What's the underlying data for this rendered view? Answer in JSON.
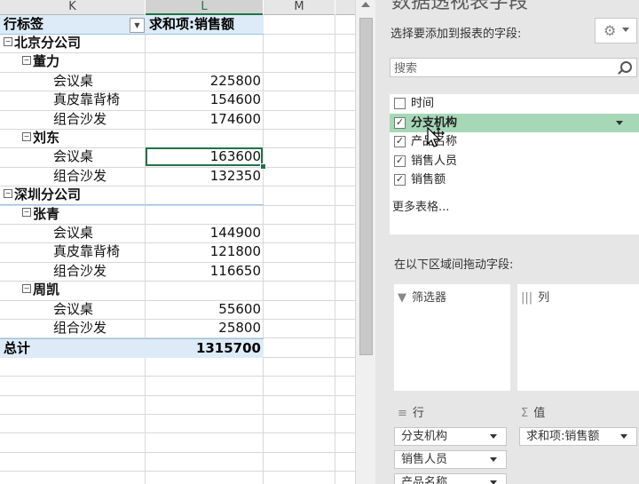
{
  "sheet": {
    "columns": [
      {
        "label": "K"
      },
      {
        "label": "L"
      },
      {
        "label": "M"
      }
    ],
    "pivot": {
      "header_row_label": "行标签",
      "header_value_label": "求和项:销售额",
      "rows": [
        {
          "level": 0,
          "collapse": "⊟",
          "label": "北京分公司",
          "value": ""
        },
        {
          "level": 1,
          "collapse": "⊟",
          "label": "董力",
          "value": ""
        },
        {
          "level": 2,
          "collapse": "",
          "label": "会议桌",
          "value": "225800"
        },
        {
          "level": 2,
          "collapse": "",
          "label": "真皮靠背椅",
          "value": "154600"
        },
        {
          "level": 2,
          "collapse": "",
          "label": "组合沙发",
          "value": "174600"
        },
        {
          "level": 1,
          "collapse": "⊟",
          "label": "刘东",
          "value": ""
        },
        {
          "level": 2,
          "collapse": "",
          "label": "会议桌",
          "value": "163600"
        },
        {
          "level": 2,
          "collapse": "",
          "label": "组合沙发",
          "value": "132350"
        },
        {
          "level": 0,
          "collapse": "⊟",
          "label": "深圳分公司",
          "value": ""
        },
        {
          "level": 1,
          "collapse": "⊟",
          "label": "张青",
          "value": ""
        },
        {
          "level": 2,
          "collapse": "",
          "label": "会议桌",
          "value": "144900"
        },
        {
          "level": 2,
          "collapse": "",
          "label": "真皮靠背椅",
          "value": "121800"
        },
        {
          "level": 2,
          "collapse": "",
          "label": "组合沙发",
          "value": "116650"
        },
        {
          "level": 1,
          "collapse": "⊟",
          "label": "周凯",
          "value": ""
        },
        {
          "level": 2,
          "collapse": "",
          "label": "会议桌",
          "value": "55600"
        },
        {
          "level": 2,
          "collapse": "",
          "label": "组合沙发",
          "value": "25800"
        }
      ],
      "total_label": "总计",
      "total_value": "1315700"
    }
  },
  "pane": {
    "title": "数据透视表字段",
    "choose_fields": "选择要添加到报表的字段:",
    "gear_icon": "gear-icon",
    "search_placeholder": "搜索",
    "fields": [
      {
        "label": "时间",
        "checked": false,
        "highlighted": false
      },
      {
        "label": "分支机构",
        "checked": true,
        "highlighted": true
      },
      {
        "label": "产品名称",
        "checked": true,
        "highlighted": false
      },
      {
        "label": "销售人员",
        "checked": true,
        "highlighted": false
      },
      {
        "label": "销售额",
        "checked": true,
        "highlighted": false
      }
    ],
    "more_tables": "更多表格...",
    "drag_instruction": "在以下区域间拖动字段:",
    "areas": {
      "filters": {
        "title": "筛选器",
        "icon": "filter-icon"
      },
      "columns": {
        "title": "列",
        "icon": "columns-icon"
      },
      "rows": {
        "title": "行",
        "icon": "rows-icon",
        "items": [
          "分支机构",
          "销售人员",
          "产品名称"
        ]
      },
      "values": {
        "title": "值",
        "icon": "sigma-icon",
        "items": [
          "求和项:销售额"
        ]
      }
    }
  },
  "colors": {
    "pivot_header_bg": "#dcebf7",
    "selection_green": "#217346",
    "field_highlight": "#a6d8b8"
  }
}
